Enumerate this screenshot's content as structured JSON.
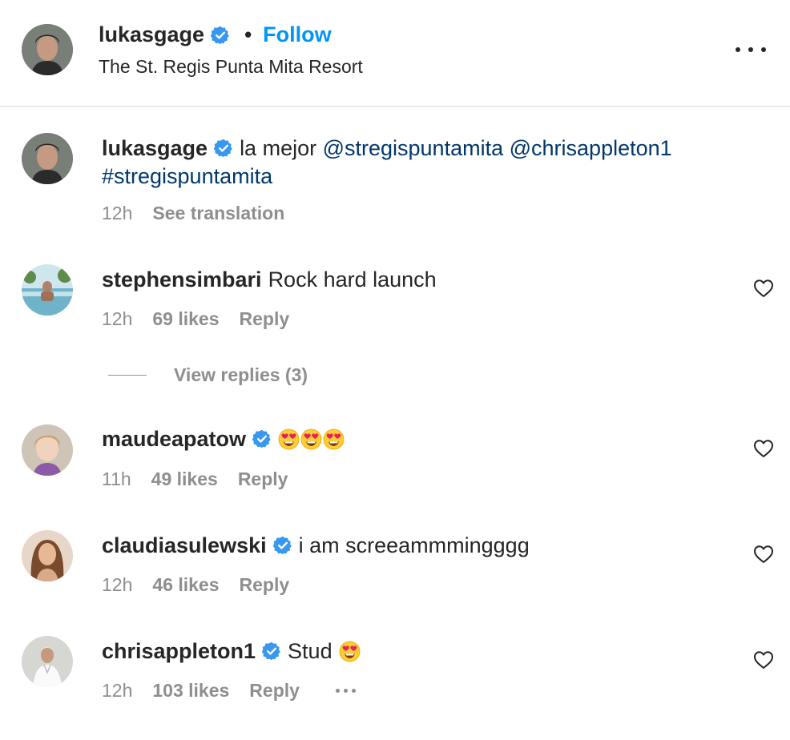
{
  "header": {
    "username": "lukasgage",
    "separator": "•",
    "follow_label": "Follow",
    "location": "The St. Regis Punta Mita Resort"
  },
  "caption": {
    "username": "lukasgage",
    "text_prefix": "la mejor ",
    "mention1": "@stregispuntamita",
    "mention2": "@chrisappleton1",
    "hashtag": "#stregispuntamita",
    "time": "12h",
    "see_translation": "See translation"
  },
  "comments": [
    {
      "username": "stephensimbari",
      "text": "Rock hard launch",
      "time": "12h",
      "likes": "69 likes",
      "reply": "Reply",
      "view_replies": "View replies (3)"
    },
    {
      "username": "maudeapatow",
      "text": "",
      "emojis": "heart-eyes x3",
      "time": "11h",
      "likes": "49 likes",
      "reply": "Reply"
    },
    {
      "username": "claudiasulewski",
      "text": "i am screeammmingggg",
      "time": "12h",
      "likes": "46 likes",
      "reply": "Reply"
    },
    {
      "username": "chrisappleton1",
      "text": "Stud",
      "emojis": "heart-eyes",
      "time": "12h",
      "likes": "103 likes",
      "reply": "Reply"
    }
  ],
  "icons": {
    "verified": "verified-badge-icon",
    "heart": "heart-outline-icon",
    "more": "more-horizontal-icon",
    "emoji": "heart-eyes-emoji"
  },
  "colors": {
    "text": "#262626",
    "secondary": "#8e8e8e",
    "link": "#00376b",
    "follow": "#0095f6",
    "verified": "#3897f0"
  }
}
